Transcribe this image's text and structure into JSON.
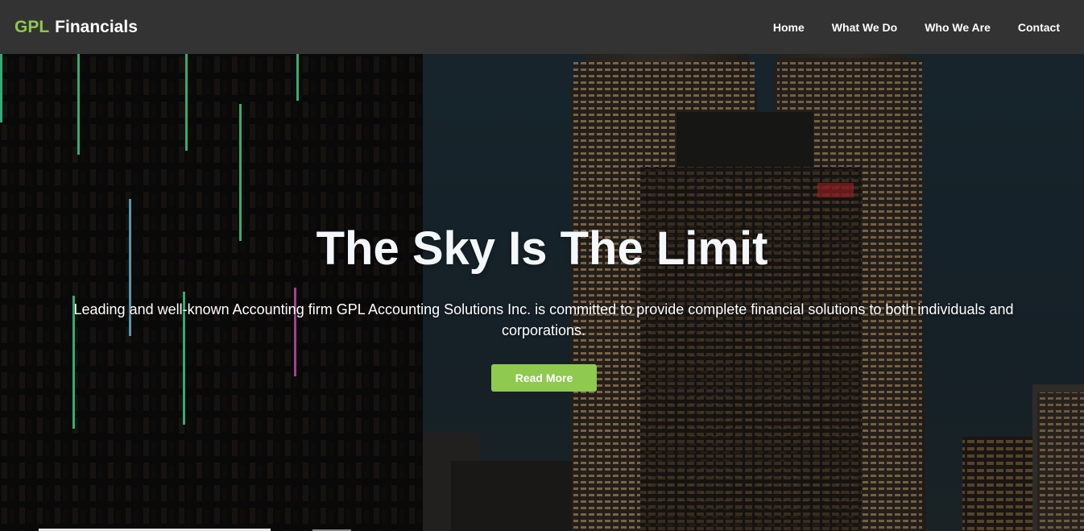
{
  "brand": {
    "accent": "GPL",
    "name": "Financials",
    "accent_color": "#8fc74f"
  },
  "nav": {
    "items": [
      {
        "label": "Home"
      },
      {
        "label": "What We Do"
      },
      {
        "label": "Who We Are"
      },
      {
        "label": "Contact"
      }
    ]
  },
  "hero": {
    "title": "The Sky Is The Limit",
    "subtitle": "Leading and well-known Accounting firm GPL Accounting Solutions Inc. is committed to provide complete financial solutions to both individuals and corporations.",
    "cta_label": "Read More",
    "cta_color": "#8fc94f",
    "background": "night-city-skyscrapers-image"
  },
  "colors": {
    "navbar_bg": "#333333",
    "text": "#ffffff"
  }
}
